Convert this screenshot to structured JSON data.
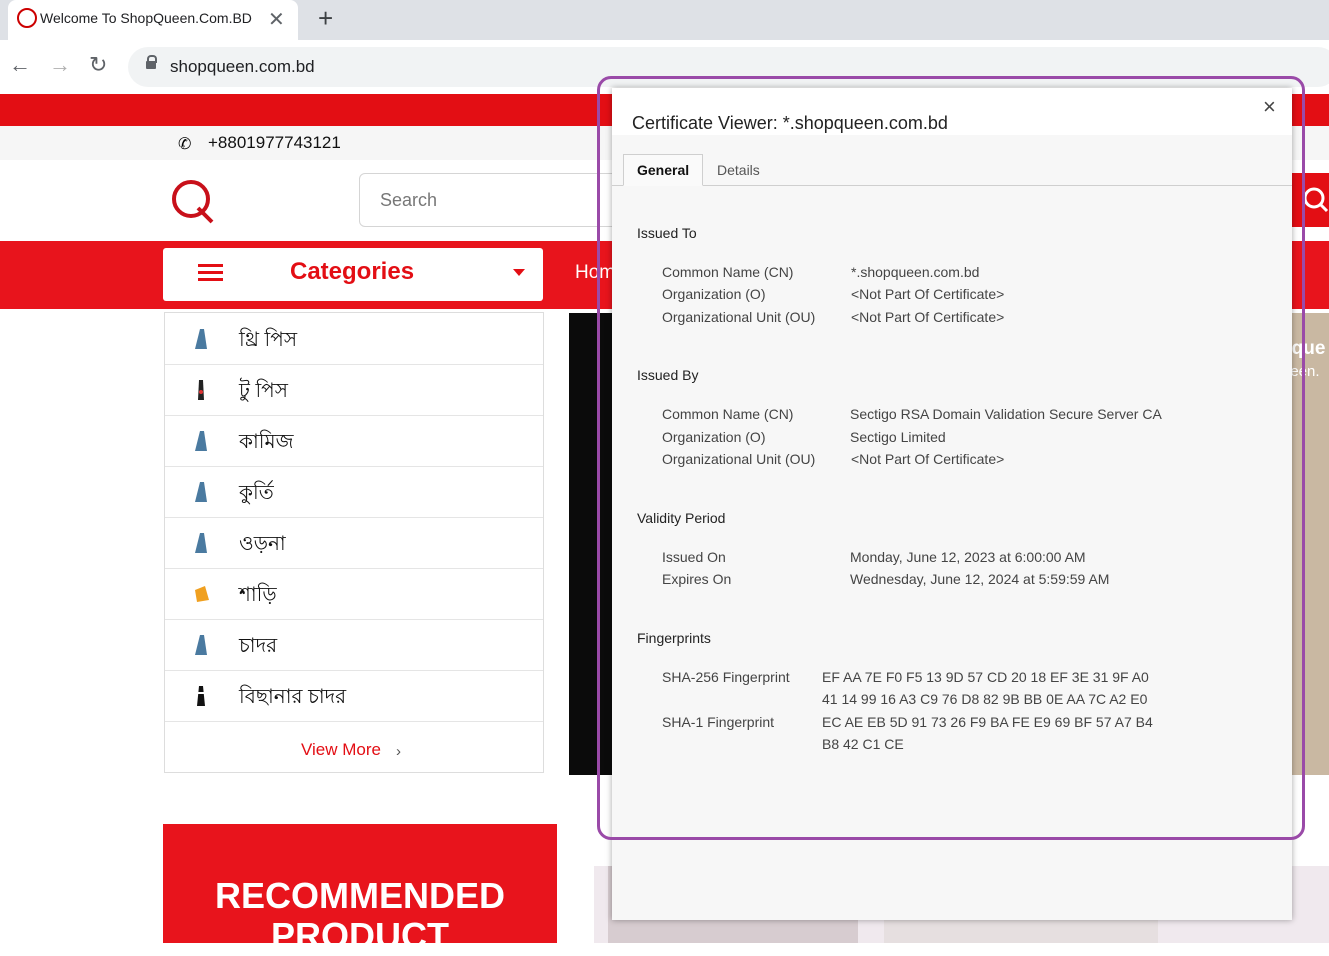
{
  "browser": {
    "tab_title": "Welcome To ShopQueen.Com.BD",
    "close_tab": "✕",
    "new_tab": "+",
    "url": "shopqueen.com.bd"
  },
  "site": {
    "phone": "+8801977743121",
    "search_placeholder": "Search",
    "categories_label": "Categories",
    "nav_home": "Hom",
    "categories": [
      {
        "label": "থ্রি পিস",
        "icon": "dress-icon"
      },
      {
        "label": "টু পিস",
        "icon": "dress-icon"
      },
      {
        "label": "কামিজ",
        "icon": "dress-icon"
      },
      {
        "label": "কুর্তি",
        "icon": "dress-icon"
      },
      {
        "label": "ওড়না",
        "icon": "dress-icon"
      },
      {
        "label": "শাড়ি",
        "icon": "saree-icon"
      },
      {
        "label": "চাদর",
        "icon": "dress-icon"
      },
      {
        "label": "বিছানার চাদর",
        "icon": "bedsheet-icon"
      }
    ],
    "view_more": "View More",
    "banner_text": "oque",
    "banner_sub": "ueen.",
    "recommended": "RECOMMENDED PRODUCT",
    "brand_red": "#e30e14"
  },
  "dialog": {
    "title": "Certificate Viewer: *.shopqueen.com.bd",
    "close": "×",
    "tabs": [
      "General",
      "Details"
    ],
    "issued_to": {
      "heading": "Issued To",
      "rows": [
        {
          "label": "Common Name (CN)",
          "value": "*.shopqueen.com.bd"
        },
        {
          "label": "Organization (O)",
          "value": "<Not Part Of Certificate>"
        },
        {
          "label": "Organizational Unit (OU)",
          "value": "<Not Part Of Certificate>"
        }
      ]
    },
    "issued_by": {
      "heading": "Issued By",
      "rows": [
        {
          "label": "Common Name (CN)",
          "value": "Sectigo RSA Domain Validation Secure Server CA"
        },
        {
          "label": "Organization (O)",
          "value": "Sectigo Limited"
        },
        {
          "label": "Organizational Unit (OU)",
          "value": "<Not Part Of Certificate>"
        }
      ]
    },
    "validity": {
      "heading": "Validity Period",
      "rows": [
        {
          "label": "Issued On",
          "value": "Monday, June 12, 2023 at 6:00:00 AM"
        },
        {
          "label": "Expires On",
          "value": "Wednesday, June 12, 2024 at 5:59:59 AM"
        }
      ]
    },
    "fingerprints": {
      "heading": "Fingerprints",
      "sha256_label": "SHA-256 Fingerprint",
      "sha256_line1": "EF AA 7E F0 F5 13 9D 57 CD 20 18 EF 3E 31 9F A0",
      "sha256_line2": "41 14 99 16 A3 C9 76 D8 82 9B BB 0E AA 7C A2 E0",
      "sha1_label": "SHA-1 Fingerprint",
      "sha1_line1": "EC AE EB 5D 91 73 26 F9 BA FE E9 69 BF 57 A7 B4",
      "sha1_line2": "B8 42 C1 CE"
    },
    "highlight_color": "#9a4aa8"
  }
}
